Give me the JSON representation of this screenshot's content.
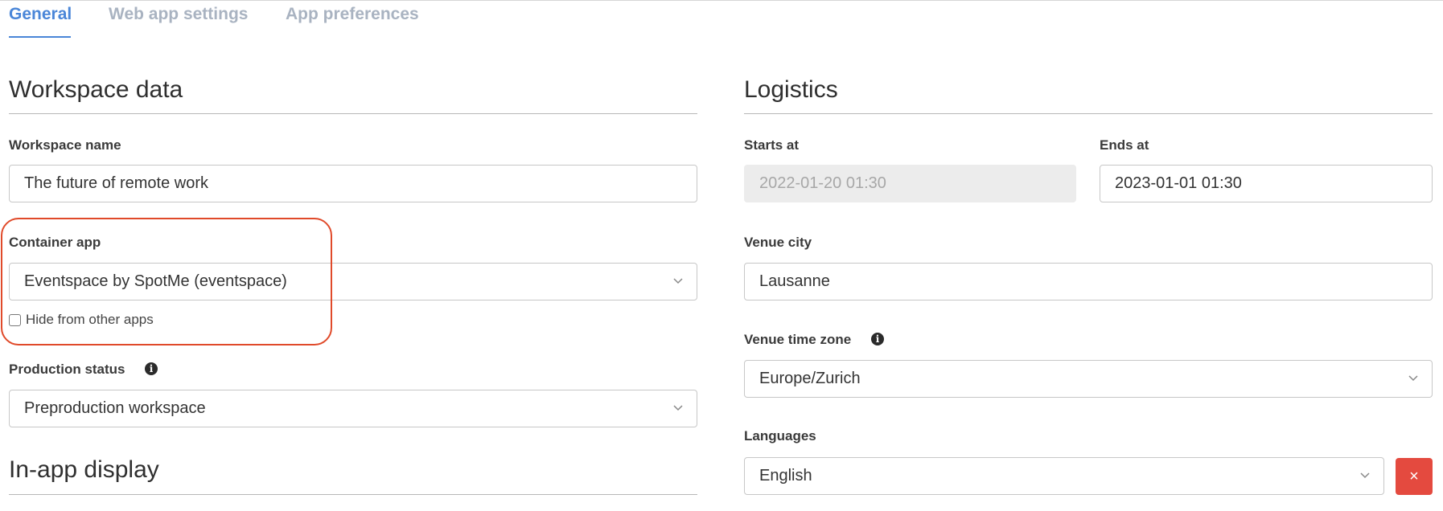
{
  "tabs": [
    {
      "label": "General",
      "active": true
    },
    {
      "label": "Web app settings",
      "active": false
    },
    {
      "label": "App preferences",
      "active": false
    }
  ],
  "workspace_data": {
    "title": "Workspace data",
    "workspace_name_label": "Workspace name",
    "workspace_name_value": "The future of remote work",
    "container_app_label": "Container app",
    "container_app_value": "Eventspace by SpotMe (eventspace)",
    "hide_checkbox_label": "Hide from other apps",
    "hide_checkbox_checked": false,
    "production_status_label": "Production status",
    "production_status_value": "Preproduction workspace"
  },
  "in_app_display": {
    "title": "In-app display"
  },
  "logistics": {
    "title": "Logistics",
    "starts_at_label": "Starts at",
    "starts_at_value": "2022-01-20 01:30",
    "ends_at_label": "Ends at",
    "ends_at_value": "2023-01-01 01:30",
    "venue_city_label": "Venue city",
    "venue_city_value": "Lausanne",
    "venue_tz_label": "Venue time zone",
    "venue_tz_value": "Europe/Zurich",
    "languages_label": "Languages",
    "languages_value": "English",
    "remove_label": "×"
  },
  "icons": {
    "info": "info-icon",
    "chevron": "chevron-down-icon"
  },
  "colors": {
    "accent": "#4a86d8",
    "highlight": "#e04a2a",
    "danger": "#e44a3f"
  }
}
